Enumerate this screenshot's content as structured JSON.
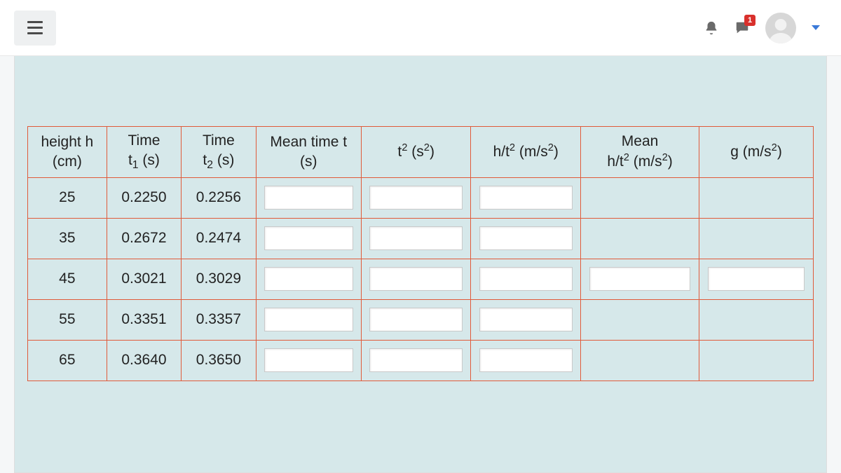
{
  "topbar": {
    "notification_count": "1"
  },
  "table": {
    "headers": {
      "height": "height h<br>(cm)",
      "t1": "Time<br>t<sub>1</sub> (s)",
      "t2": "Time<br>t<sub>2</sub> (s)",
      "mean_t": "Mean time t<br>(s)",
      "t_sq": "t<sup>2</sup> (s<sup>2</sup>)",
      "h_over_t2": "h/t<sup>2</sup> (m/s<sup>2</sup>)",
      "mean_h_over_t2": "Mean<br>h/t<sup>2</sup> (m/s<sup>2</sup>)",
      "g": "g (m/s<sup>2</sup>)"
    },
    "rows": [
      {
        "height": "25",
        "t1": "0.2250",
        "t2": "0.2256",
        "mean_t": "",
        "t_sq": "",
        "h_over_t2": "",
        "mean_h_over_t2": "",
        "g": "",
        "show_mean": false,
        "show_g": false
      },
      {
        "height": "35",
        "t1": "0.2672",
        "t2": "0.2474",
        "mean_t": "",
        "t_sq": "",
        "h_over_t2": "",
        "mean_h_over_t2": "",
        "g": "",
        "show_mean": false,
        "show_g": false
      },
      {
        "height": "45",
        "t1": "0.3021",
        "t2": "0.3029",
        "mean_t": "",
        "t_sq": "",
        "h_over_t2": "",
        "mean_h_over_t2": "",
        "g": "",
        "show_mean": true,
        "show_g": true
      },
      {
        "height": "55",
        "t1": "0.3351",
        "t2": "0.3357",
        "mean_t": "",
        "t_sq": "",
        "h_over_t2": "",
        "mean_h_over_t2": "",
        "g": "",
        "show_mean": false,
        "show_g": false
      },
      {
        "height": "65",
        "t1": "0.3640",
        "t2": "0.3650",
        "mean_t": "",
        "t_sq": "",
        "h_over_t2": "",
        "mean_h_over_t2": "",
        "g": "",
        "show_mean": false,
        "show_g": false
      }
    ]
  }
}
